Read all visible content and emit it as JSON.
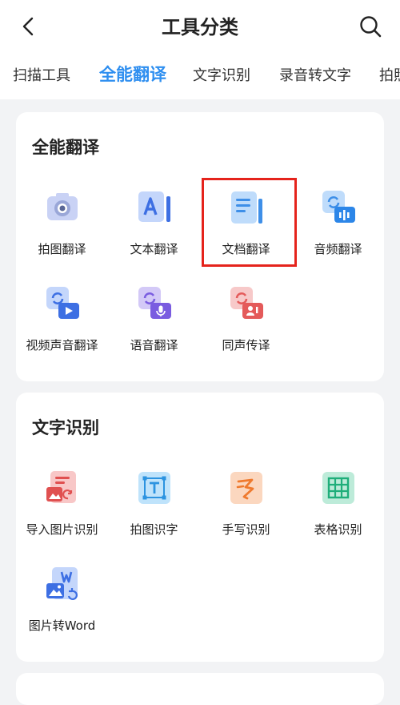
{
  "header": {
    "title": "工具分类"
  },
  "tabs": [
    {
      "label": "扫描工具",
      "active": false
    },
    {
      "label": "全能翻译",
      "active": true
    },
    {
      "label": "文字识别",
      "active": false
    },
    {
      "label": "录音转文字",
      "active": false
    },
    {
      "label": "拍照",
      "active": false
    }
  ],
  "sections": [
    {
      "title": "全能翻译",
      "items": [
        {
          "label": "拍图翻译",
          "icon": "camera-translate-icon"
        },
        {
          "label": "文本翻译",
          "icon": "text-translate-icon"
        },
        {
          "label": "文档翻译",
          "icon": "document-translate-icon",
          "highlighted": true
        },
        {
          "label": "音频翻译",
          "icon": "audio-translate-icon"
        },
        {
          "label": "视频声音翻译",
          "icon": "video-translate-icon"
        },
        {
          "label": "语音翻译",
          "icon": "voice-translate-icon"
        },
        {
          "label": "同声传译",
          "icon": "simultaneous-interpretation-icon"
        }
      ]
    },
    {
      "title": "文字识别",
      "items": [
        {
          "label": "导入图片识别",
          "icon": "import-image-recognition-icon"
        },
        {
          "label": "拍图识字",
          "icon": "photo-text-recognition-icon"
        },
        {
          "label": "手写识别",
          "icon": "handwriting-recognition-icon"
        },
        {
          "label": "表格识别",
          "icon": "table-recognition-icon"
        },
        {
          "label": "图片转Word",
          "icon": "image-to-word-icon"
        }
      ]
    }
  ],
  "colors": {
    "accent": "#2f8ff0",
    "highlight": "#e5231c",
    "background": "#f2f3f5"
  }
}
